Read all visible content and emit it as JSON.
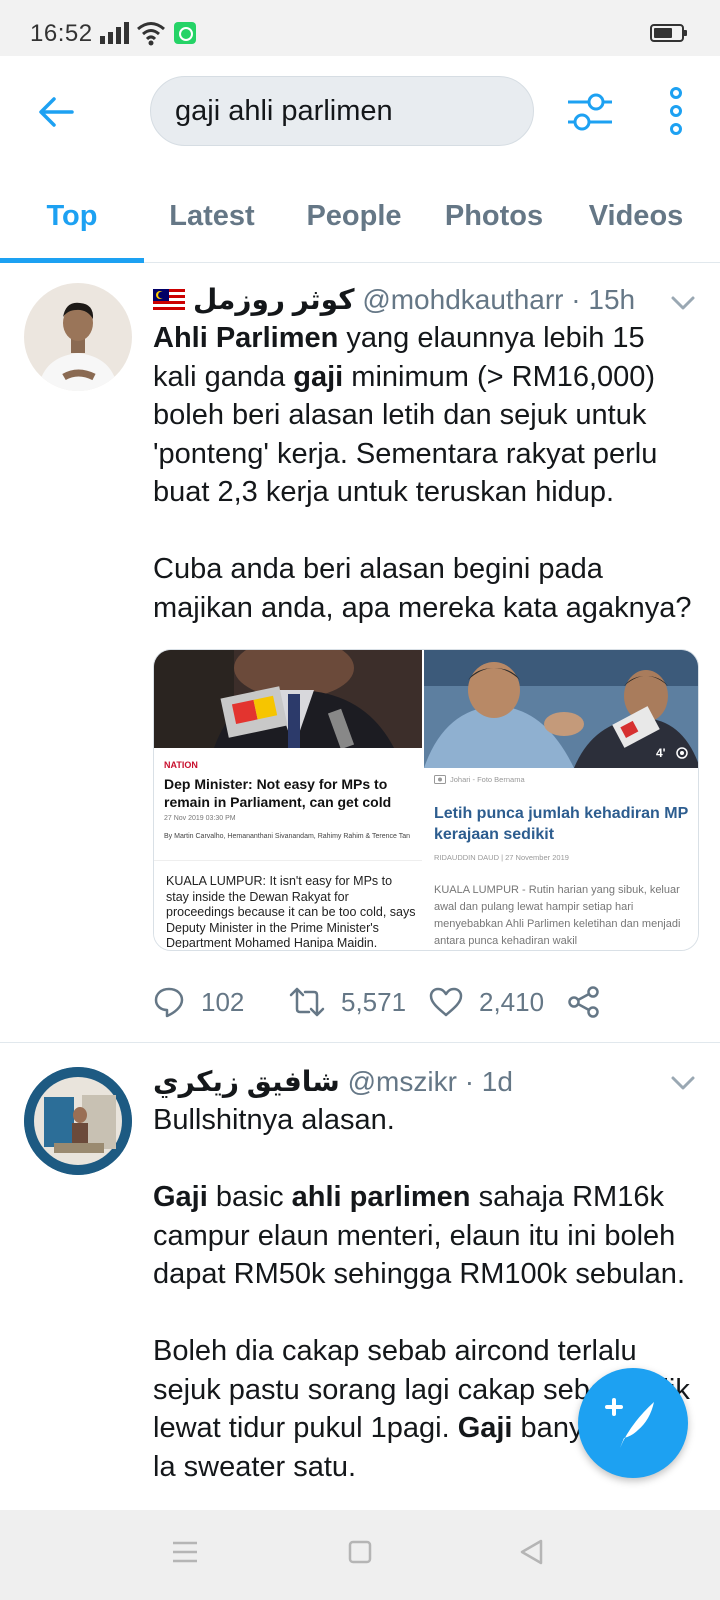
{
  "status_bar": {
    "time": "16:52"
  },
  "search": {
    "query": "gaji ahli parlimen"
  },
  "tabs": [
    {
      "label": "Top",
      "active": true
    },
    {
      "label": "Latest",
      "active": false
    },
    {
      "label": "People",
      "active": false
    },
    {
      "label": "Photos",
      "active": false
    },
    {
      "label": "Videos",
      "active": false
    }
  ],
  "colors": {
    "accent": "#1da1f2",
    "secondary_text": "#657786"
  },
  "tweets": [
    {
      "display_name": "كوثر روزمل",
      "handle": "@mohdkautharr",
      "time": "· 15h",
      "paragraph1": {
        "b1": "Ahli Parlimen",
        "t1": " yang elaunnya lebih 15 kali ganda ",
        "b2": "gaji",
        "t2": " minimum (> RM16,000) boleh beri alasan letih dan sejuk untuk 'ponteng' kerja. Sementara rakyat perlu buat 2,3 kerja untuk teruskan hidup."
      },
      "paragraph2": "Cuba anda beri alasan begini pada majikan anda, apa mereka kata agaknya?",
      "card_left": {
        "section": "NATION",
        "headline": "Dep Minister: Not easy for MPs to remain in Parliament, can get cold",
        "date": "27 Nov 2019 03:30 PM",
        "byline": "By Martin Carvalho, Hemananthani Sivanandam, Rahimy Rahim & Terence Tan",
        "excerpt": "KUALA LUMPUR: It isn't easy for MPs to stay inside the Dewan Rakyat for proceedings because it can be too cold, says Deputy Minister in the Prime Minister's Department Mohamed Hanipa Maidin."
      },
      "card_right": {
        "photo_credit": "Johari - Foto Bernama",
        "headline": "Letih punca jumlah kehadiran MP kerajaan sedikit",
        "byline": "RIDAUDDIN DAUD | 27 November 2019",
        "excerpt": "KUALA LUMPUR - Rutin harian yang sibuk, keluar awal dan pulang lewat hampir setiap hari menyebabkan Ahli Parlimen keletihan dan menjadi antara punca kehadiran wakil",
        "video_badge": "4'"
      },
      "replies": "102",
      "retweets": "5,571",
      "likes": "2,410"
    },
    {
      "display_name": "شافيق زيكري",
      "handle": "@mszikr",
      "time": "· 1d",
      "line1": "Bullshitnya alasan.",
      "paragraph2": {
        "b1": "Gaji",
        "t1": " basic ",
        "b2": "ahli parlimen",
        "t2": " sahaja RM16k campur elaun menteri, elaun itu ini boleh dapat RM50k sehingga RM100k sebulan."
      },
      "paragraph3": {
        "t1": "Boleh dia cakap sebab aircond terlalu sejuk pastu sorang lagi cakap sebab balik lewat tidur pukul 1pagi. ",
        "b1": "Gaji",
        "t2": " banyak beli la sweater satu."
      }
    }
  ]
}
